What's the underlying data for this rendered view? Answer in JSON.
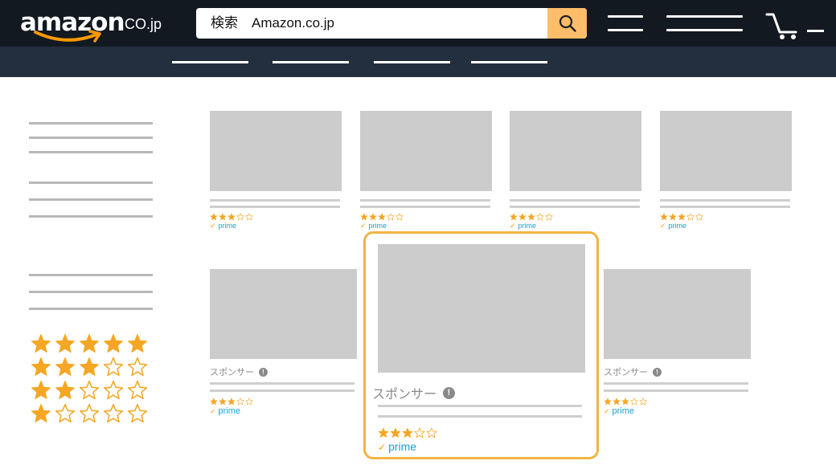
{
  "header": {
    "logo_text": "amazon",
    "logo_suffix": "CO.jp",
    "search": {
      "placeholder": "検索　Amazon.co.jp"
    }
  },
  "colors": {
    "header_bg": "#131921",
    "subnav_bg": "#232f3e",
    "search_button": "#febd69",
    "star": "#f5a623",
    "prime": "#1f9fd0",
    "highlight_border": "#f3b443",
    "placeholder_gray": "#cccccc"
  },
  "icons": {
    "search_button": "search-icon",
    "cart": "cart-icon",
    "logo_smile": "amazon-smile-icon"
  },
  "sidebar": {
    "rating_filters": [
      {
        "filled": 5
      },
      {
        "filled": 3
      },
      {
        "filled": 2
      },
      {
        "filled": 1
      }
    ]
  },
  "products": [
    {
      "rating": 3,
      "prime": "prime",
      "sponsored": false
    },
    {
      "rating": 3,
      "prime": "prime",
      "sponsored": false
    },
    {
      "rating": 3,
      "prime": "prime",
      "sponsored": false
    },
    {
      "rating": 3,
      "prime": "prime",
      "sponsored": false
    },
    {
      "rating": 3,
      "prime": "prime",
      "sponsored": true,
      "sponsor_label": "スポンサー",
      "info": "!"
    },
    {
      "rating": 3,
      "prime": "prime",
      "sponsored": true,
      "sponsor_label": "スポンサー",
      "info": "!",
      "highlighted": true
    },
    {
      "rating": 3,
      "prime": "prime",
      "sponsored": true,
      "sponsor_label": "スポンサー",
      "info": "!"
    }
  ]
}
